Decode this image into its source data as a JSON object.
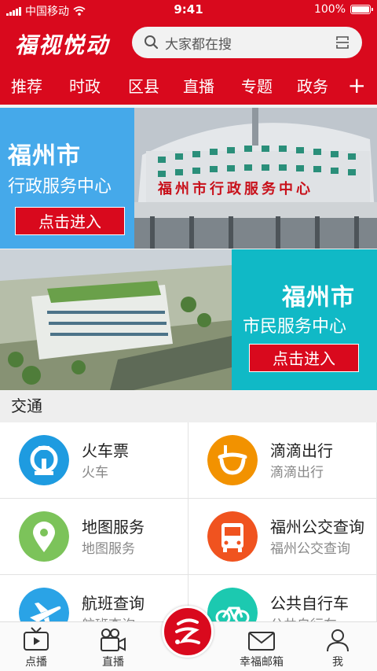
{
  "status_bar": {
    "carrier": "中国移动",
    "time": "9:41",
    "battery_text": "100%",
    "battery_level": 1.0
  },
  "header": {
    "app_name": "福视悦动",
    "search_placeholder": "大家都在搜"
  },
  "nav_tabs": [
    {
      "label": "推荐"
    },
    {
      "label": "时政"
    },
    {
      "label": "区县"
    },
    {
      "label": "直播"
    },
    {
      "label": "专题"
    },
    {
      "label": "政务"
    }
  ],
  "nav_add_label": "+",
  "banners": [
    {
      "title": "福州市",
      "subtitle": "行政服务中心",
      "button": "点击进入",
      "color": "#45a9ea",
      "photo_sign": "福州市行政服务中心"
    },
    {
      "title": "福州市",
      "subtitle": "市民服务中心",
      "button": "点击进入",
      "color": "#10b9c6"
    }
  ],
  "section": {
    "title": "交通",
    "items": [
      {
        "title": "火车票",
        "subtitle": "火车",
        "icon": "train-logo-icon",
        "color": "#1e9be0"
      },
      {
        "title": "滴滴出行",
        "subtitle": "滴滴出行",
        "icon": "didi-icon",
        "color": "#f29200"
      },
      {
        "title": "地图服务",
        "subtitle": "地图服务",
        "icon": "map-pin-icon",
        "color": "#7cc35a"
      },
      {
        "title": "福州公交查询",
        "subtitle": "福州公交查询",
        "icon": "bus-icon",
        "color": "#f0531f"
      },
      {
        "title": "航班查询",
        "subtitle": "航班查询",
        "icon": "airplane-icon",
        "color": "#2aa3e6"
      },
      {
        "title": "公共自行车",
        "subtitle": "公共自行车",
        "icon": "bicycle-icon",
        "color": "#1cc9b0"
      }
    ]
  },
  "bottom_nav": [
    {
      "label": "点播",
      "icon": "tv-icon"
    },
    {
      "label": "直播",
      "icon": "video-camera-icon"
    },
    {
      "label": "",
      "icon": "center-logo-icon"
    },
    {
      "label": "幸福邮箱",
      "icon": "mail-icon"
    },
    {
      "label": "我",
      "icon": "user-icon"
    }
  ]
}
